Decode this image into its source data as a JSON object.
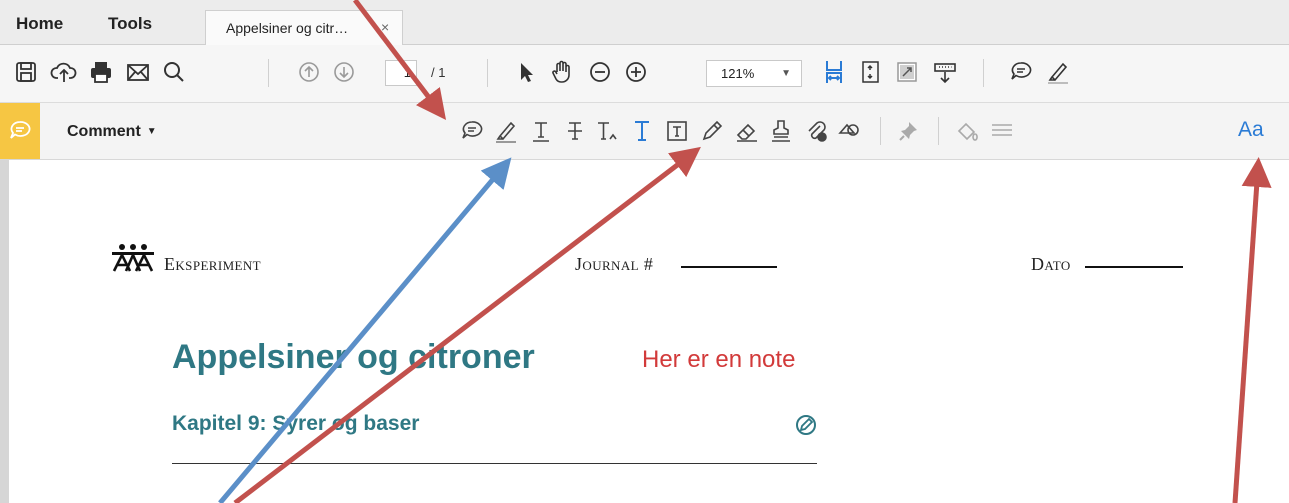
{
  "tabs": {
    "home": "Home",
    "tools": "Tools",
    "document": "Appelsiner og citr…",
    "close": "×"
  },
  "toolbar": {
    "icons": [
      "save-icon",
      "upload-icon",
      "print-icon",
      "email-icon",
      "search-icon",
      "page-up-icon",
      "page-down-icon",
      "select-cursor-icon",
      "hand-icon",
      "zoom-out-icon",
      "zoom-in-icon",
      "fit-width-icon",
      "fit-page-icon",
      "full-screen-icon",
      "read-mode-icon",
      "sticky-note-icon",
      "highlight-pen-icon"
    ],
    "page_current": "1",
    "page_total": "/ 1",
    "zoom_value": "121%"
  },
  "comment_bar": {
    "label": "Comment",
    "aa_label": "Aa",
    "accent": "#f6c643",
    "icons": [
      "add-note-icon",
      "highlight-text-icon",
      "underline-text-icon",
      "strikethrough-icon",
      "replace-text-icon",
      "add-text-icon",
      "text-box-icon",
      "pencil-icon",
      "eraser-icon",
      "stamp-icon",
      "attach-file-icon",
      "shapes-icon",
      "pin-icon",
      "fill-color-icon",
      "line-weight-icon",
      "font-icon"
    ]
  },
  "document": {
    "experiment_label": "Eksperiment",
    "journal_label": "Journal #",
    "date_label": "Dato",
    "title": "Appelsiner og citroner",
    "note": "Her er en note",
    "chapter": "Kapitel 9: Syrer og baser"
  },
  "colors": {
    "title_teal": "#2f7884",
    "note_red": "#d23a3a",
    "arrow_red": "#c2514d",
    "arrow_blue": "#5b8fc8",
    "accent_blue": "#2a7bd5"
  }
}
